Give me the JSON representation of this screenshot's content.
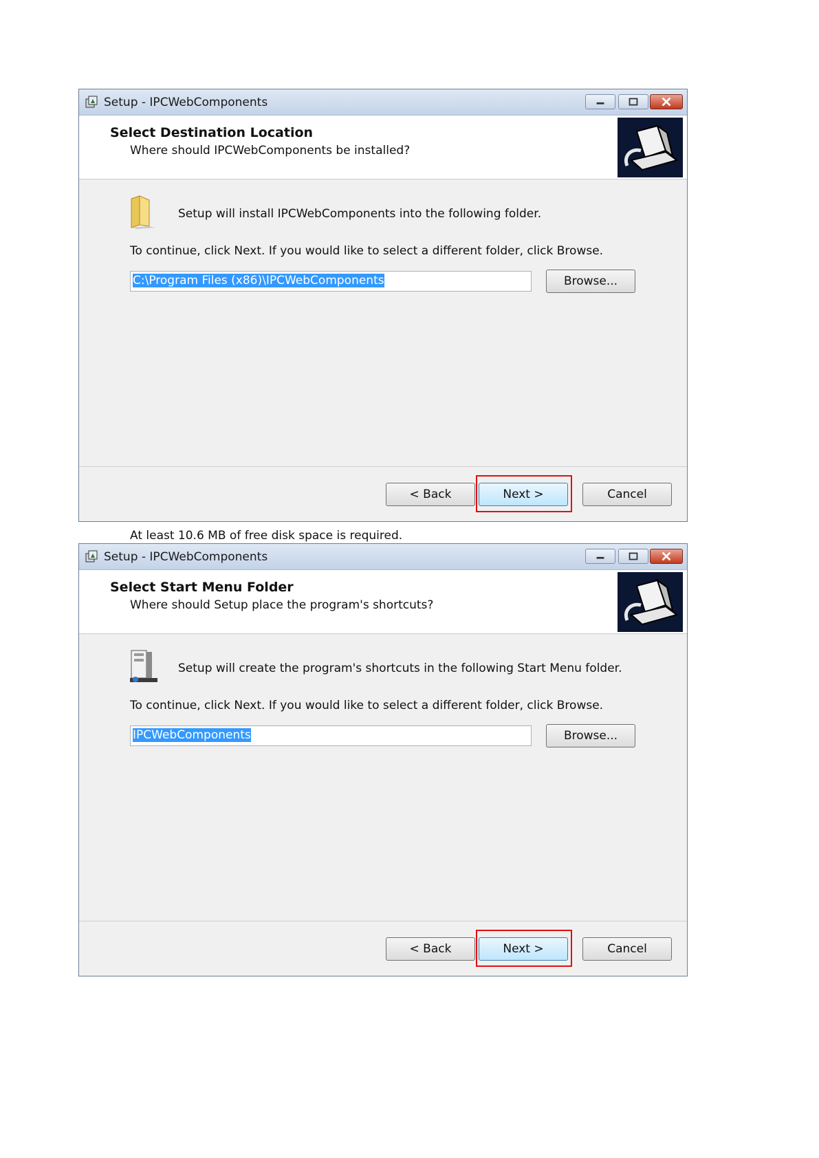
{
  "dialogs": [
    {
      "window_title": "Setup - IPCWebComponents",
      "header_title": "Select Destination Location",
      "header_subtitle": "Where should IPCWebComponents be installed?",
      "intro": "Setup will install IPCWebComponents into the following folder.",
      "instruction": "To continue, click Next. If you would like to select a different folder, click Browse.",
      "input_value": "C:\\Program Files (x86)\\IPCWebComponents",
      "browse_label": "Browse...",
      "disk_space": "At least 10.6 MB of free disk space is required.",
      "back_label": "< Back",
      "next_label": "Next >",
      "cancel_label": "Cancel",
      "icon": "folder-icon"
    },
    {
      "window_title": "Setup - IPCWebComponents",
      "header_title": "Select Start Menu Folder",
      "header_subtitle": "Where should Setup place the program's shortcuts?",
      "intro": "Setup will create the program's shortcuts in the following Start Menu folder.",
      "instruction": "To continue, click Next. If you would like to select a different folder, click Browse.",
      "input_value": "IPCWebComponents",
      "browse_label": "Browse...",
      "back_label": "< Back",
      "next_label": "Next >",
      "cancel_label": "Cancel",
      "icon": "start-menu-folder-icon"
    }
  ],
  "colors": {
    "highlight": "#e01010",
    "selection": "#3399ff"
  }
}
